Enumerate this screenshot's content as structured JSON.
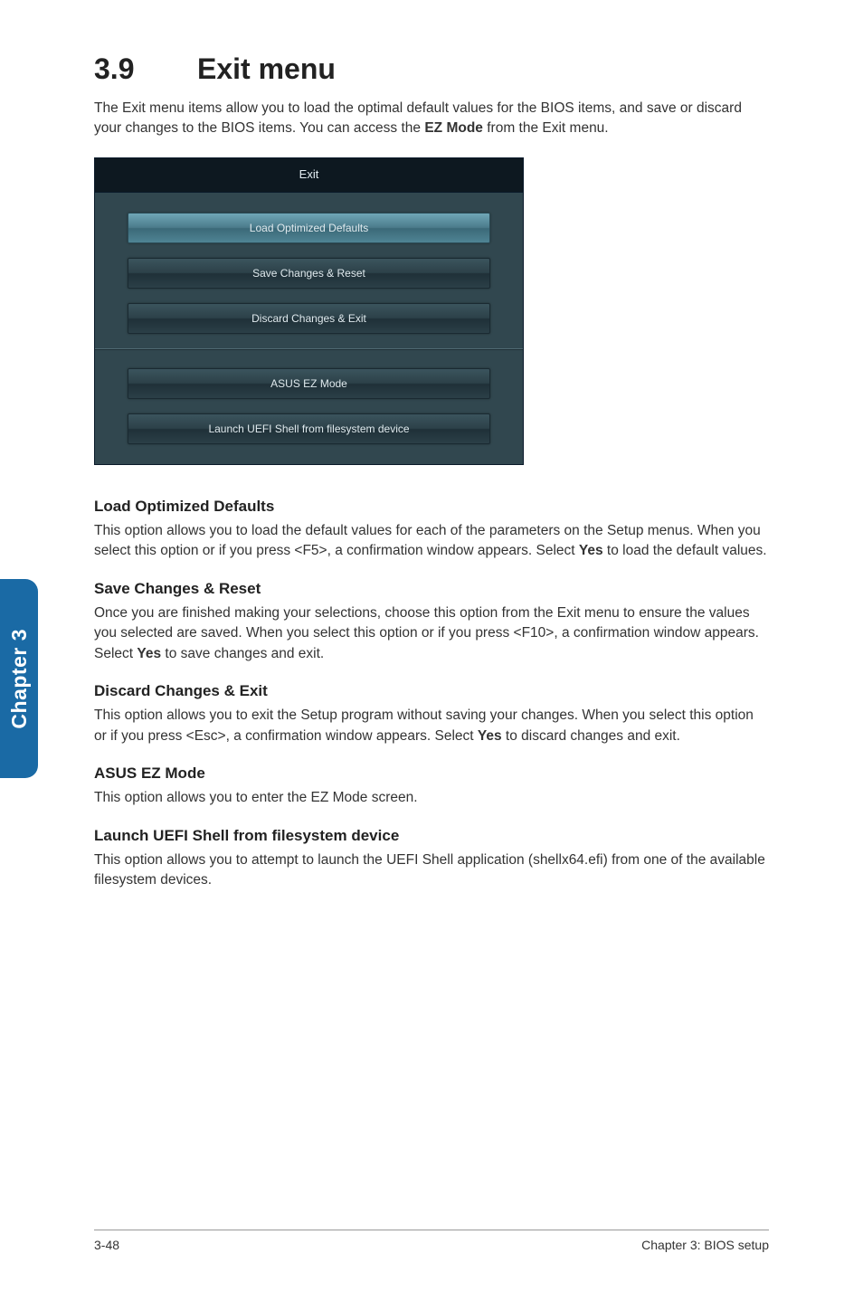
{
  "heading": {
    "number": "3.9",
    "title": "Exit menu"
  },
  "intro_parts": {
    "a": "The Exit menu items allow you to load the optimal default values for the BIOS items, and save or discard your changes to the BIOS items. You can access the ",
    "b": "EZ Mode",
    "c": " from the Exit menu."
  },
  "menu": {
    "title": "Exit",
    "items": [
      {
        "label": "Load Optimized Defaults",
        "highlight": true
      },
      {
        "label": "Save Changes & Reset",
        "highlight": false
      },
      {
        "label": "Discard Changes & Exit",
        "highlight": false
      }
    ],
    "items2": [
      {
        "label": "ASUS EZ Mode",
        "highlight": false
      },
      {
        "label": "Launch UEFI Shell from filesystem device",
        "highlight": false
      }
    ]
  },
  "sections": [
    {
      "h": "Load Optimized Defaults",
      "p": [
        {
          "t": "This option allows you to load the default values for each of the parameters on the Setup menus. When you select this option or if you press <F5>, a confirmation window appears. Select "
        },
        {
          "t": "Yes",
          "b": true
        },
        {
          "t": " to load the default values."
        }
      ]
    },
    {
      "h": "Save Changes & Reset",
      "p": [
        {
          "t": "Once you are finished making your selections, choose this option from the Exit menu to ensure the values you selected are saved. When you select this option or if you press <F10>, a confirmation window appears. Select "
        },
        {
          "t": "Yes",
          "b": true
        },
        {
          "t": " to save changes and exit."
        }
      ]
    },
    {
      "h": "Discard Changes & Exit",
      "p": [
        {
          "t": "This option allows you to exit the Setup program without saving your changes. When you select this option or if you press <Esc>, a confirmation window appears. Select "
        },
        {
          "t": "Yes",
          "b": true
        },
        {
          "t": " to discard changes and exit."
        }
      ]
    },
    {
      "h": "ASUS EZ Mode",
      "p": [
        {
          "t": "This option allows you to enter the EZ Mode screen."
        }
      ]
    },
    {
      "h": "Launch UEFI Shell from filesystem device",
      "p": [
        {
          "t": "This option allows you to attempt to launch the UEFI Shell application (shellx64.efi) from one of the available filesystem devices."
        }
      ]
    }
  ],
  "side_tab": "Chapter 3",
  "footer": {
    "left": "3-48",
    "right": "Chapter 3: BIOS setup"
  }
}
